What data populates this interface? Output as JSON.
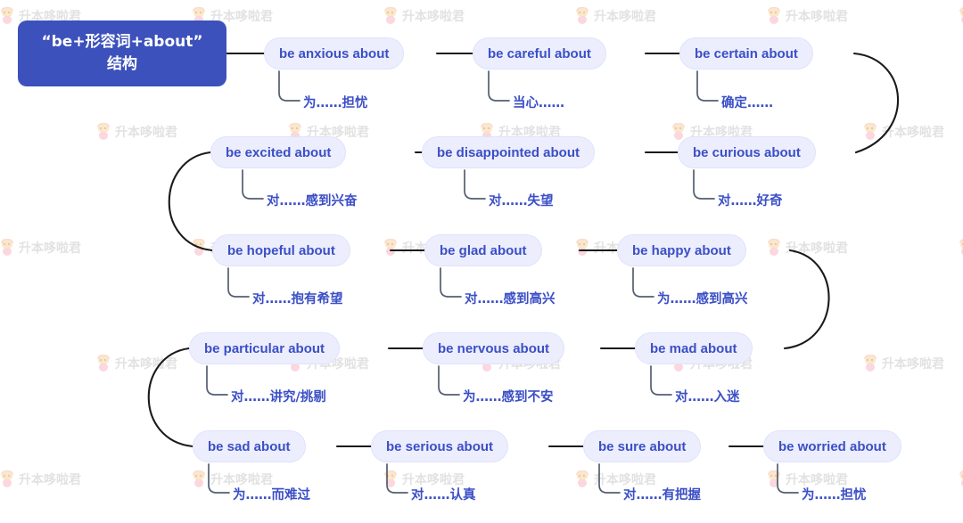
{
  "title": "“be+形容词+about” 结构",
  "root": {
    "line1": "“be+形容词+about”",
    "line2": "结构"
  },
  "colors": {
    "root_bg": "#3c51bb",
    "root_text": "#ffffff",
    "pill_bg": "#eceefd",
    "pill_border": "#dfe3fb",
    "pill_text": "#3b4fc6",
    "sublabel_text": "#3b4fc6",
    "edge": "#1a1a1a",
    "page_bg": "#ffffff",
    "watermark_text": "#e2e2e2"
  },
  "watermark": {
    "text": "升本哆啦君",
    "icon": "chibi-figure-icon"
  },
  "rows": [
    {
      "id": "row-1",
      "nodes": [
        {
          "label": "be anxious about",
          "sub": "为……担忧"
        },
        {
          "label": "be careful about",
          "sub": "当心……"
        },
        {
          "label": "be certain about",
          "sub": "确定……"
        }
      ]
    },
    {
      "id": "row-2",
      "nodes": [
        {
          "label": "be excited about",
          "sub": "对……感到兴奋"
        },
        {
          "label": "be disappointed about",
          "sub": "对……失望"
        },
        {
          "label": "be curious about",
          "sub": "对……好奇"
        }
      ]
    },
    {
      "id": "row-3",
      "nodes": [
        {
          "label": "be hopeful about",
          "sub": "对……抱有希望"
        },
        {
          "label": "be glad about",
          "sub": "对……感到高兴"
        },
        {
          "label": "be happy about",
          "sub": "为……感到高兴"
        }
      ]
    },
    {
      "id": "row-4",
      "nodes": [
        {
          "label": "be particular about",
          "sub": "对……讲究/挑剔"
        },
        {
          "label": "be nervous about",
          "sub": "为……感到不安"
        },
        {
          "label": "be mad about",
          "sub": "对……入迷"
        }
      ]
    },
    {
      "id": "row-5",
      "nodes": [
        {
          "label": "be sad about",
          "sub": "为……而难过"
        },
        {
          "label": "be serious about",
          "sub": "对……认真"
        },
        {
          "label": "be sure about",
          "sub": "对……有把握"
        },
        {
          "label": "be worried about",
          "sub": "为……担忧"
        }
      ]
    }
  ]
}
